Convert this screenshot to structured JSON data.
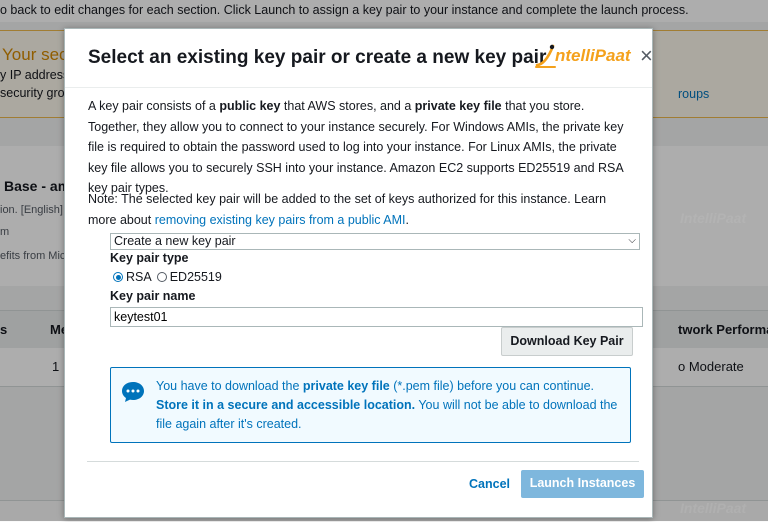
{
  "background": {
    "instruction": "o back to edit changes for each section. Click Launch to assign a key pair to your instance and complete the launch process.",
    "warning_title": "Your sec",
    "warning_line1": "y IP address",
    "warning_line2": "security gro",
    "warning_link": "roups",
    "ami_title": "Base - ami-",
    "ami_line1": "ion. [English]",
    "ami_line2": "m",
    "ami_line3": "efits from Mic",
    "col_s": "s",
    "col_me": "Me",
    "col_network": "twork Performance",
    "row_count": "1",
    "row_network": "o Moderate",
    "watermark": "IntelliPaat"
  },
  "modal": {
    "title": "Select an existing key pair or create a new key pair",
    "logo_text": "ntelliPaat",
    "close_label": "×",
    "p1": {
      "t1": "A key pair consists of a ",
      "b1": "public key",
      "t2": " that AWS stores, and a ",
      "b2": "private key file",
      "t3": " that you store. Together, they allow you to connect to your instance securely. For Windows AMIs, the private key file is required to obtain the password used to log into your instance. For Linux AMIs, the private key file allows you to securely SSH into your instance. Amazon EC2 supports ED25519 and RSA key pair types."
    },
    "p2": {
      "t1": "Note: The selected key pair will be added to the set of keys authorized for this instance. Learn more about ",
      "link": "removing existing key pairs from a public AMI",
      "t2": "."
    },
    "select_value": "Create a new key pair",
    "key_pair_type_label": "Key pair type",
    "rsa_label": "RSA",
    "ed_label": "ED25519",
    "key_pair_name_label": "Key pair name",
    "key_pair_name_value": "keytest01",
    "download_button": "Download Key Pair",
    "info": {
      "t1": "You have to download the ",
      "b1": "private key file",
      "t2": " (*.pem file) before you can continue. ",
      "b2": "Store it in a secure and accessible location.",
      "t3": " You will not be able to download the file again after it's created."
    },
    "cancel_button": "Cancel",
    "launch_button": "Launch Instances"
  },
  "colors": {
    "link": "#0073bb",
    "primary_disabled": "#7eb7dd",
    "logo_orange": "#f4a11c",
    "warning": "#d48a00"
  }
}
